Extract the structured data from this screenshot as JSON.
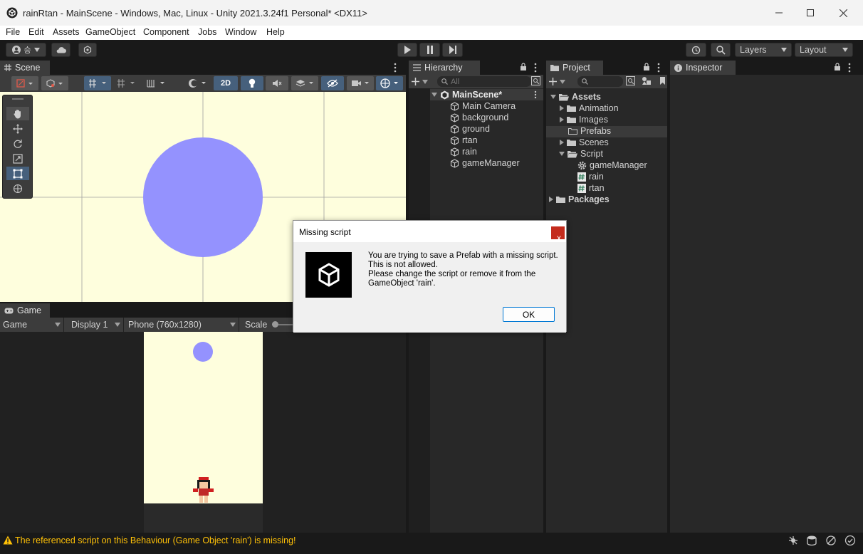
{
  "window": {
    "title": "rainRtan - MainScene - Windows, Mac, Linux - Unity 2021.3.24f1 Personal* <DX11>"
  },
  "menu": [
    "File",
    "Edit",
    "Assets",
    "GameObject",
    "Component",
    "Jobs",
    "Window",
    "Help"
  ],
  "toolbar": {
    "account_label": "승",
    "layers_label": "Layers",
    "layout_label": "Layout"
  },
  "scene": {
    "tab_label": "Scene",
    "mode_2d_label": "2D",
    "background_color": "#fefedd",
    "circle_color": "#9492fe"
  },
  "game": {
    "tab_label": "Game",
    "view_select": "Game",
    "display_select": "Display 1",
    "resolution_select": "Phone (760x1280)",
    "scale_label": "Scale"
  },
  "hierarchy": {
    "tab_label": "Hierarchy",
    "search_placeholder": "All",
    "scene_name": "MainScene*",
    "objects": [
      "Main Camera",
      "background",
      "ground",
      "rtan",
      "rain",
      "gameManager"
    ]
  },
  "project": {
    "tab_label": "Project",
    "assets_label": "Assets",
    "folders": [
      "Animation",
      "Images",
      "Prefabs",
      "Scenes",
      "Script"
    ],
    "scripts": [
      "gameManager",
      "rain",
      "rtan"
    ],
    "packages_label": "Packages"
  },
  "inspector": {
    "tab_label": "Inspector"
  },
  "dialog": {
    "title": "Missing script",
    "close_label": "x",
    "line1": "You are trying to save a Prefab with a missing script.",
    "line2": "This is not allowed.",
    "line3": "Please change the script or remove it from the",
    "line4": "GameObject 'rain'.",
    "ok_label": "OK"
  },
  "status": {
    "message": "The referenced script on this Behaviour (Game Object 'rain') is missing!",
    "warning_color": "#ffc107"
  }
}
